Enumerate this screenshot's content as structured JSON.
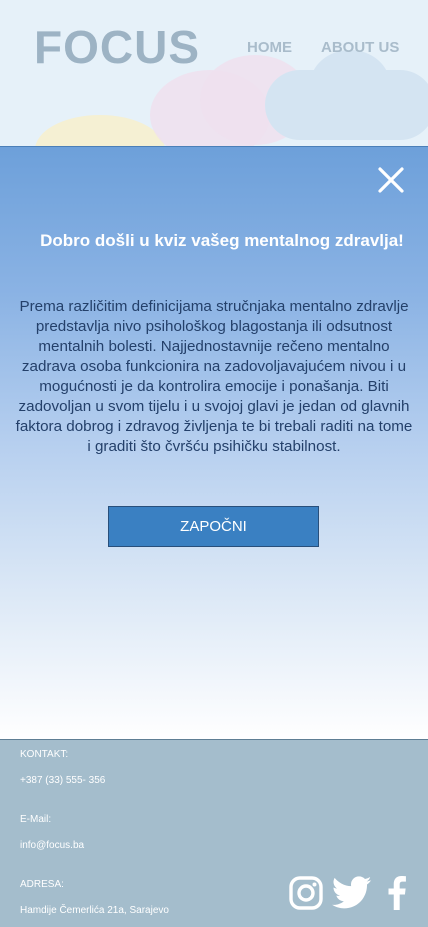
{
  "header": {
    "logo": "FOCUS",
    "nav": {
      "home": "HOME",
      "about": "ABOUT US"
    }
  },
  "modal": {
    "title": "Dobro došli u kviz vašeg mentalnog zdravlja!",
    "description": "Prema različitim definicijama stručnjaka mentalno zdravlje predstavlja nivo psihološkog blagostanja ili odsutnost mentalnih bolesti. Najjednostavnije rečeno mentalno zadrava osoba funkcionira na zadovoljavajućem nivou i u mogućnosti je da kontrolira emocije i ponašanja. Biti zadovoljan u svom tijelu i u svojoj glavi je jedan od glavnih faktora dobrog i zdravog življenja te bi trebali raditi na tome i graditi što čvršću psihičku stabilnost.",
    "start_label": "ZAPOČNI",
    "close_icon": "close-icon"
  },
  "footer": {
    "contact_label": "KONTAKT:",
    "phone": "+387 (33) 555- 356",
    "email_label": "E-Mail:",
    "email": "info@focus.ba",
    "address_label": "ADRESA:",
    "address": "Hamdije Čemerlića 21a, Sarajevo",
    "social_icons": [
      "instagram-icon",
      "twitter-icon",
      "facebook-icon"
    ]
  },
  "colors": {
    "modal_top": "#6da0da",
    "button": "#3a80c2",
    "footer": "#a4bdcc",
    "logo": "#9db3c4"
  }
}
